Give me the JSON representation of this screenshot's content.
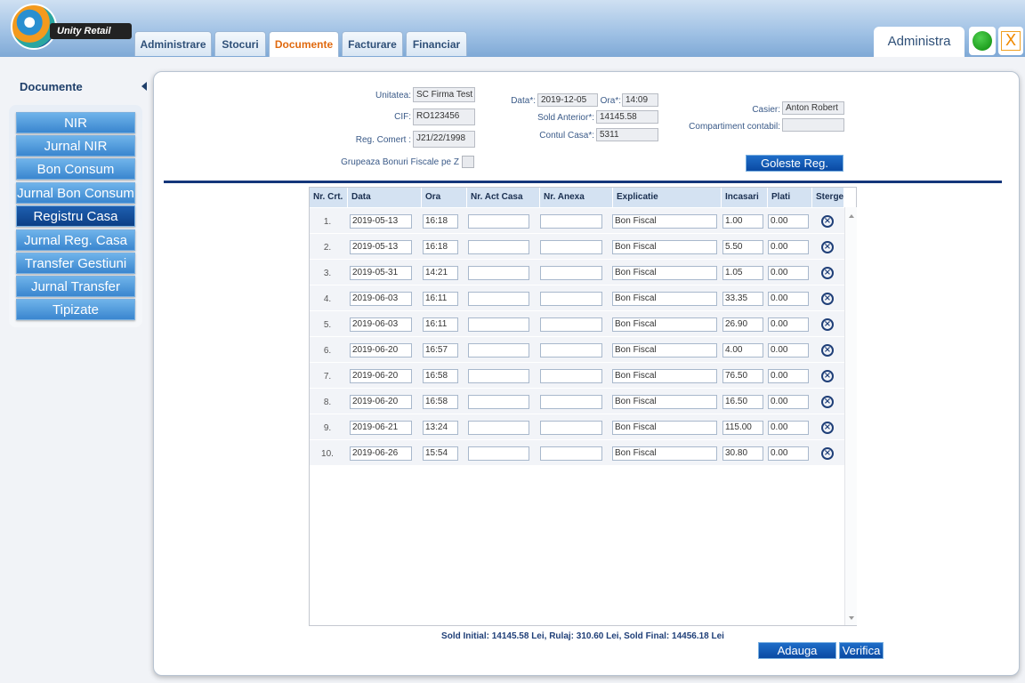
{
  "app": {
    "logo_text": "Unity Retail"
  },
  "tabs": [
    {
      "label": "Administrare"
    },
    {
      "label": "Stocuri"
    },
    {
      "label": "Documente"
    },
    {
      "label": "Facturare"
    },
    {
      "label": "Financiar"
    }
  ],
  "admin_label": "Administra",
  "close_label": "X",
  "sidebar": {
    "title": "Documente",
    "items": [
      {
        "label": "NIR"
      },
      {
        "label": "Jurnal NIR"
      },
      {
        "label": "Bon Consum"
      },
      {
        "label": "Jurnal Bon Consum"
      },
      {
        "label": "Registru Casa"
      },
      {
        "label": "Jurnal Reg. Casa"
      },
      {
        "label": "Transfer Gestiuni"
      },
      {
        "label": "Jurnal Transfer"
      },
      {
        "label": "Tipizate"
      }
    ]
  },
  "form": {
    "unitatea_label": "Unitatea:",
    "unitatea": "SC Firma Test SRL",
    "cif_label": "CIF:",
    "cif": "RO123456",
    "reg_label": "Reg. Comert :",
    "reg": "J21/22/1998",
    "grupeaza_label": "Grupeaza Bonuri Fiscale pe Z",
    "data_label": "Data*:",
    "data": "2019-12-05",
    "ora_label": "Ora*:",
    "ora": "14:09",
    "sold_label": "Sold Anterior*:",
    "sold": "14145.58",
    "cont_label": "Contul Casa*:",
    "cont": "5311",
    "casier_label": "Casier:",
    "casier": "Anton Robert",
    "comp_label": "Compartiment contabil:",
    "comp": "",
    "goleste_label": "Goleste Reg. Casa"
  },
  "table": {
    "headers": {
      "nr": "Nr. Crt.",
      "data": "Data",
      "ora": "Ora",
      "act": "Nr. Act Casa",
      "anexa": "Nr. Anexa",
      "expl": "Explicatie",
      "inc": "Incasari",
      "plati": "Plati",
      "sterge": "Sterge"
    },
    "rows": [
      {
        "nr": "1.",
        "data": "2019-05-13",
        "ora": "16:18",
        "act": "",
        "anexa": "",
        "expl": "Bon Fiscal",
        "inc": "1.00",
        "plati": "0.00"
      },
      {
        "nr": "2.",
        "data": "2019-05-13",
        "ora": "16:18",
        "act": "",
        "anexa": "",
        "expl": "Bon Fiscal",
        "inc": "5.50",
        "plati": "0.00"
      },
      {
        "nr": "3.",
        "data": "2019-05-31",
        "ora": "14:21",
        "act": "",
        "anexa": "",
        "expl": "Bon Fiscal",
        "inc": "1.05",
        "plati": "0.00"
      },
      {
        "nr": "4.",
        "data": "2019-06-03",
        "ora": "16:11",
        "act": "",
        "anexa": "",
        "expl": "Bon Fiscal",
        "inc": "33.35",
        "plati": "0.00"
      },
      {
        "nr": "5.",
        "data": "2019-06-03",
        "ora": "16:11",
        "act": "",
        "anexa": "",
        "expl": "Bon Fiscal",
        "inc": "26.90",
        "plati": "0.00"
      },
      {
        "nr": "6.",
        "data": "2019-06-20",
        "ora": "16:57",
        "act": "",
        "anexa": "",
        "expl": "Bon Fiscal",
        "inc": "4.00",
        "plati": "0.00"
      },
      {
        "nr": "7.",
        "data": "2019-06-20",
        "ora": "16:58",
        "act": "",
        "anexa": "",
        "expl": "Bon Fiscal",
        "inc": "76.50",
        "plati": "0.00"
      },
      {
        "nr": "8.",
        "data": "2019-06-20",
        "ora": "16:58",
        "act": "",
        "anexa": "",
        "expl": "Bon Fiscal",
        "inc": "16.50",
        "plati": "0.00"
      },
      {
        "nr": "9.",
        "data": "2019-06-21",
        "ora": "13:24",
        "act": "",
        "anexa": "",
        "expl": "Bon Fiscal",
        "inc": "115.00",
        "plati": "0.00"
      },
      {
        "nr": "10.",
        "data": "2019-06-26",
        "ora": "15:54",
        "act": "",
        "anexa": "",
        "expl": "Bon Fiscal",
        "inc": "30.80",
        "plati": "0.00"
      }
    ]
  },
  "totals": "Sold Initial: 14145.58 Lei, Rulaj: 310.60 Lei, Sold Final: 14456.18 Lei",
  "buttons": {
    "adauga": "Adauga Pozitie",
    "verifica": "Verifica"
  }
}
